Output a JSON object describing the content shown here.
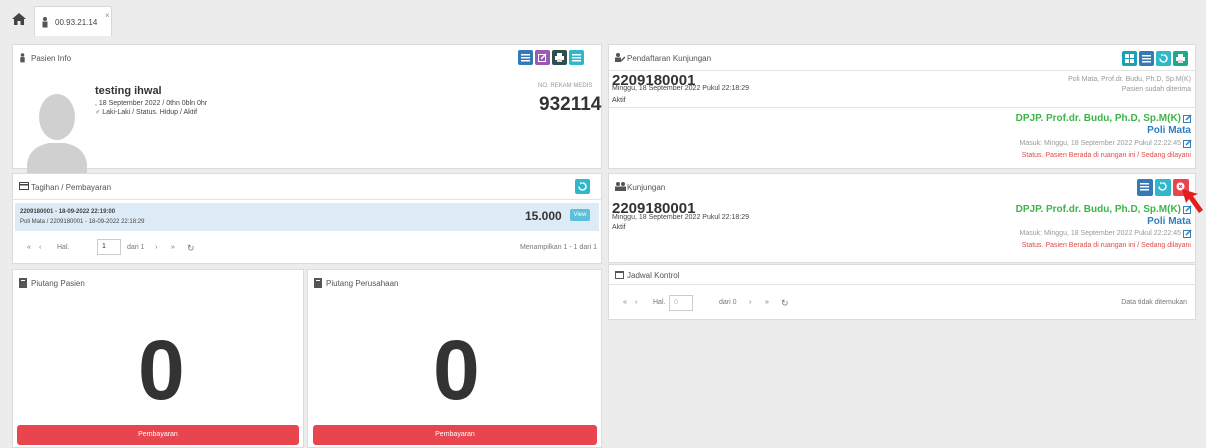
{
  "topbar": {
    "tab_label": "00.93.21.14",
    "tab_close": "×"
  },
  "pasien_info": {
    "title": "Pasien Info",
    "name": "testing ihwal",
    "dob": ", 18 September 2022 / 0thn 0bln 0hr",
    "gender_status": "♂ Laki-Laki / Status. Hidup / Aktif",
    "rm_label": "NO. REKAM MEDIS",
    "rm_number": "932114"
  },
  "pendaftaran": {
    "title": "Pendaftaran Kunjungan",
    "number": "2209180001",
    "date": "Minggu, 18 September 2022 Pukul 22:18:29",
    "status": "Aktif",
    "poli_doctor": "Poli Mata, Prof.dr. Budu, Ph.D, Sp.M(K)",
    "accepted": "Pasien sudah diterima",
    "dpjp": "DPJP. Prof.dr. Budu, Ph.D, Sp.M(K)",
    "poli": "Poli Mata",
    "masuk": "Masuk: Minggu, 18 September 2022 Pukul 22:22:45",
    "room_status": "Status. Pasien Berada di ruangan ini / Sedang dilayani"
  },
  "tagihan": {
    "title": "Tagihan / Pembayaran",
    "row_line1": "2209180001 - 18-09-2022 22:19:00",
    "row_line2": "Poli Mata / 2209180001 - 18-09-2022 22:18:29",
    "amount": "15.000",
    "view_label": "View",
    "hal_label": "Hal.",
    "page_value": "1",
    "dari": "dari 1",
    "showing": "Menampilkan 1 - 1 dari 1"
  },
  "kunjungan": {
    "title": "Kunjungan",
    "number": "2209180001",
    "date": "Minggu, 18 September 2022 Pukul 22:18:29",
    "status": "Aktif",
    "dpjp": "DPJP. Prof.dr. Budu, Ph.D, Sp.M(K)",
    "poli": "Poli Mata",
    "masuk": "Masuk: Minggu, 18 September 2022 Pukul 22:22:45",
    "room_status": "Status. Pasien Berada di ruangan ini / Sedang dilayani"
  },
  "jadwal": {
    "title": "Jadwal Kontrol",
    "hal_label": "Hal.",
    "page_value": "0",
    "dari": "dari 0",
    "empty": "Data tidak ditemukan"
  },
  "piutang_pasien": {
    "title": "Piutang Pasien",
    "value": "0",
    "button": "Pembayaran"
  },
  "piutang_perusahaan": {
    "title": "Piutang Perusahaan",
    "value": "0",
    "button": "Pembayaran"
  },
  "colors": {
    "accent_red": "#e8454f",
    "green": "#3cb54a",
    "blue": "#2f7fc1"
  }
}
